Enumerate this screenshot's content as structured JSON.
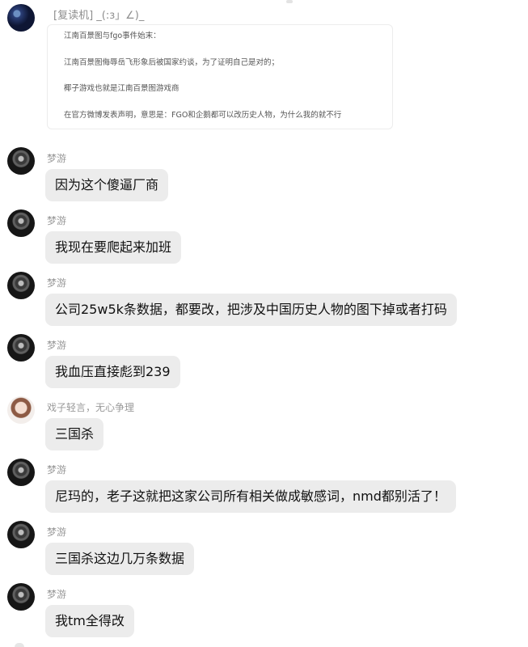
{
  "header": {
    "nickname": "[复读机] _(:з」∠)_",
    "forwarded_lines": [
      "江南百景图与fgo事件始末：",
      "江南百景图侮辱岳飞形象后被国家约谈，为了证明自己是对的；",
      "椰子游戏也就是江南百景图游戏商",
      "在官方微博发表声明，意思是：FGO和企鹅都可以改历史人物，为什么我的就不行"
    ]
  },
  "messages": [
    {
      "sender": "梦游",
      "text": "因为这个傻逼厂商"
    },
    {
      "sender": "梦游",
      "text": "我现在要爬起来加班"
    },
    {
      "sender": "梦游",
      "text": "公司25w5k条数据，都要改，把涉及中国历史人物的图下掉或者打码"
    },
    {
      "sender": "梦游",
      "text": "我血压直接彪到239"
    },
    {
      "sender": "戏子轻言，无心争理",
      "text": "三国杀"
    },
    {
      "sender": "梦游",
      "text": "尼玛的，老子这就把这家公司所有相关做成敏感词，nmd都别活了！"
    },
    {
      "sender": "梦游",
      "text": "三国杀这边几万条数据"
    },
    {
      "sender": "梦游",
      "text": "我tm全得改"
    }
  ]
}
